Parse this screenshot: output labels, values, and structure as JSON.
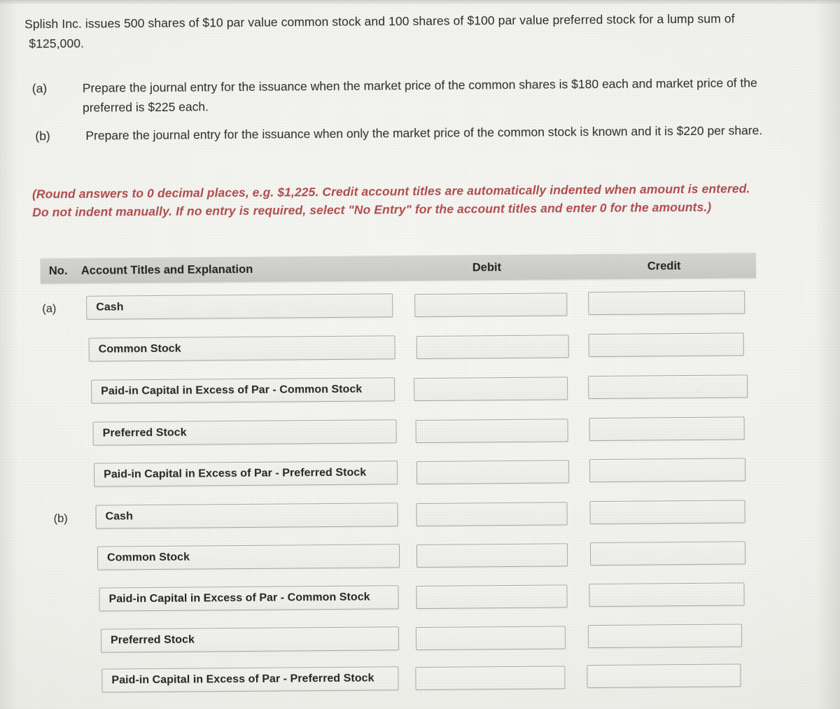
{
  "question": {
    "stem_line1": "Splish Inc. issues 500 shares of $10 par value common stock and 100 shares of $100 par value preferred stock for a lump sum of",
    "stem_line2": "$125,000.",
    "parts": [
      {
        "tag": "(a)",
        "text": "Prepare the journal entry for the issuance when the market price of the common shares is $180 each and market price of the preferred is $225 each."
      },
      {
        "tag": "(b)",
        "text": "Prepare the journal entry for the issuance when only the market price of the common stock is known and it is $220 per share."
      }
    ],
    "note": "(Round answers to 0 decimal places, e.g. $1,225. Credit account titles are automatically indented when amount is entered. Do not indent manually. If no entry is required, select \"No Entry\" for the account titles and enter 0 for the amounts.)",
    "note_color": "#b8494a"
  },
  "journal_table": {
    "headers": {
      "no": "No.",
      "account": "Account Titles and Explanation",
      "debit": "Debit",
      "credit": "Credit"
    },
    "header_bg": "#d0d0cd",
    "rows": [
      {
        "tag": "(a)",
        "account": "Cash",
        "debit": "",
        "credit": ""
      },
      {
        "tag": "",
        "account": "Common Stock",
        "debit": "",
        "credit": ""
      },
      {
        "tag": "",
        "account": "Paid-in Capital in Excess of Par - Common Stock",
        "debit": "",
        "credit": ""
      },
      {
        "tag": "",
        "account": "Preferred Stock",
        "debit": "",
        "credit": ""
      },
      {
        "tag": "",
        "account": "Paid-in Capital in Excess of Par - Preferred Stock",
        "debit": "",
        "credit": ""
      },
      {
        "tag": "(b)",
        "account": "Cash",
        "debit": "",
        "credit": ""
      },
      {
        "tag": "",
        "account": "Common Stock",
        "debit": "",
        "credit": ""
      },
      {
        "tag": "",
        "account": "Paid-in Capital in Excess of Par - Common Stock",
        "debit": "",
        "credit": ""
      },
      {
        "tag": "",
        "account": "Preferred Stock",
        "debit": "",
        "credit": ""
      },
      {
        "tag": "",
        "account": "Paid-in Capital in Excess of Par - Preferred Stock",
        "debit": "",
        "credit": ""
      }
    ]
  }
}
